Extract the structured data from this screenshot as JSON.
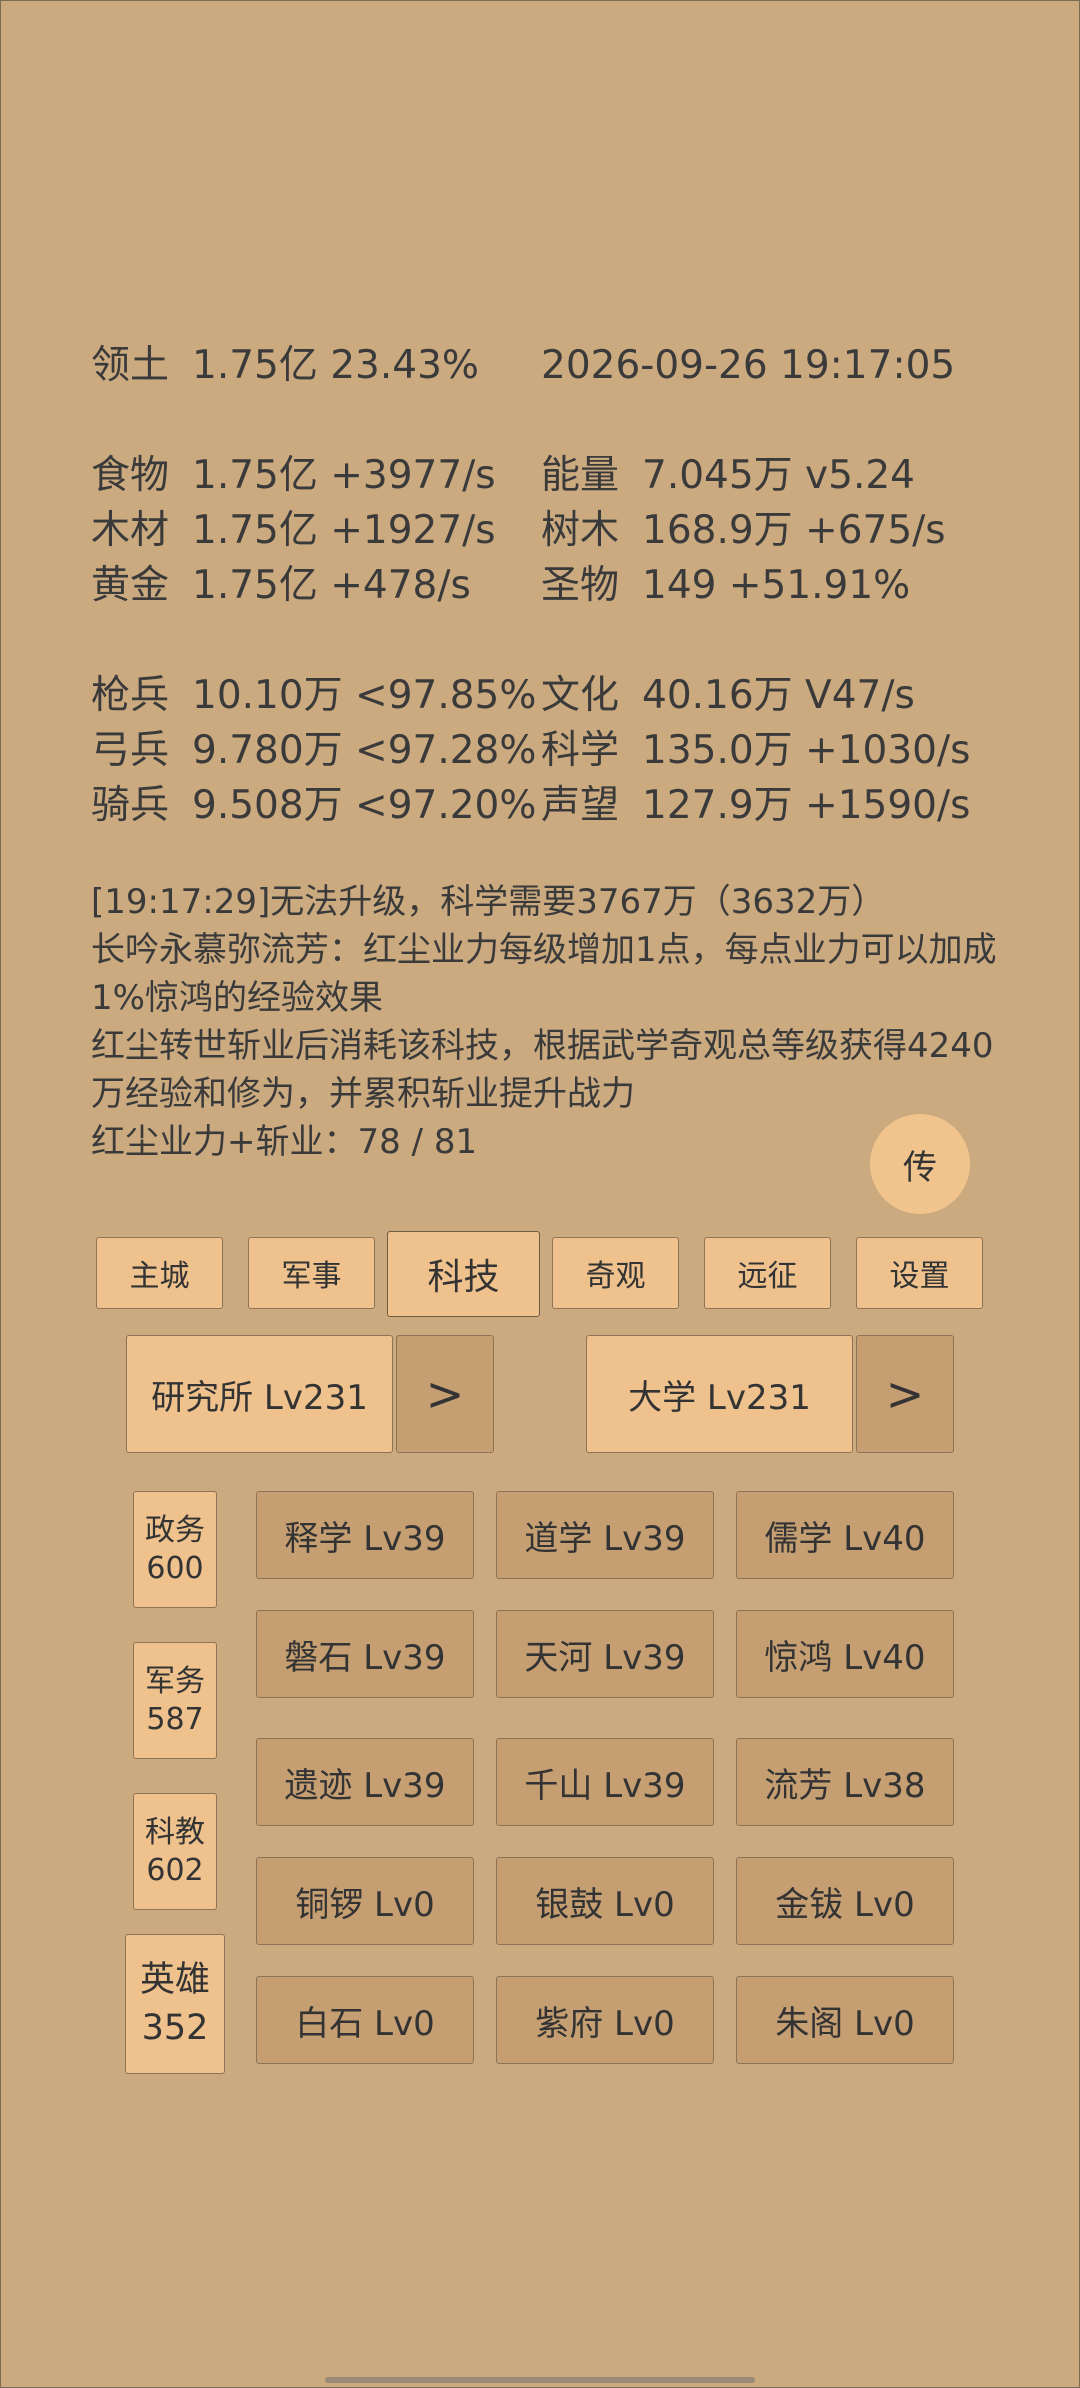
{
  "header": {
    "territory_label": "领土",
    "territory_value": "1.75亿  23.43%",
    "datetime": "2026-09-26 19:17:05"
  },
  "resources_left": [
    {
      "label": "食物",
      "value": "1.75亿 +3977/s"
    },
    {
      "label": "木材",
      "value": "1.75亿 +1927/s"
    },
    {
      "label": "黄金",
      "value": "1.75亿 +478/s"
    }
  ],
  "resources_right": [
    {
      "label": "能量",
      "value": "7.045万  v5.24"
    },
    {
      "label": "树木",
      "value": "168.9万 +675/s"
    },
    {
      "label": "圣物",
      "value": "149 +51.91%"
    }
  ],
  "troops": [
    {
      "label": "枪兵",
      "value": "10.10万 <97.85%"
    },
    {
      "label": "弓兵",
      "value": "9.780万 <97.28%"
    },
    {
      "label": "骑兵",
      "value": "9.508万 <97.20%"
    }
  ],
  "culture": [
    {
      "label": "文化",
      "value": "40.16万 V47/s"
    },
    {
      "label": "科学",
      "value": "135.0万 +1030/s"
    },
    {
      "label": "声望",
      "value": "127.9万 +1590/s"
    }
  ],
  "log": {
    "line1": "[19:17:29]无法升级，科学需要3767万（3632万）",
    "line2": "长吟永慕弥流芳：红尘业力每级增加1点，每点业力可以加成1%惊鸿的经验效果",
    "line3": "红尘转世斩业后消耗该科技，根据武学奇观总等级获得4240万经验和修为，并累积斩业提升战力",
    "line4": "红尘业力+斩业：78 / 81"
  },
  "chuan_button": "传",
  "tabs": [
    "主城",
    "军事",
    "科技",
    "奇观",
    "远征",
    "设置"
  ],
  "active_tab": "科技",
  "buildings": {
    "institute": "研究所 Lv231",
    "university": "大学 Lv231",
    "arrow": ">"
  },
  "categories": [
    {
      "name": "政务",
      "value": "600"
    },
    {
      "name": "军务",
      "value": "587"
    },
    {
      "name": "科教",
      "value": "602"
    },
    {
      "name": "英雄",
      "value": "352"
    }
  ],
  "techs": [
    [
      "释学 Lv39",
      "道学 Lv39",
      "儒学 Lv40"
    ],
    [
      "磐石 Lv39",
      "天河 Lv39",
      "惊鸿 Lv40"
    ],
    [
      "遗迹 Lv39",
      "千山 Lv39",
      "流芳 Lv38"
    ],
    [
      "铜锣 Lv0",
      "银鼓 Lv0",
      "金钹 Lv0"
    ],
    [
      "白石 Lv0",
      "紫府 Lv0",
      "朱阁 Lv0"
    ]
  ]
}
